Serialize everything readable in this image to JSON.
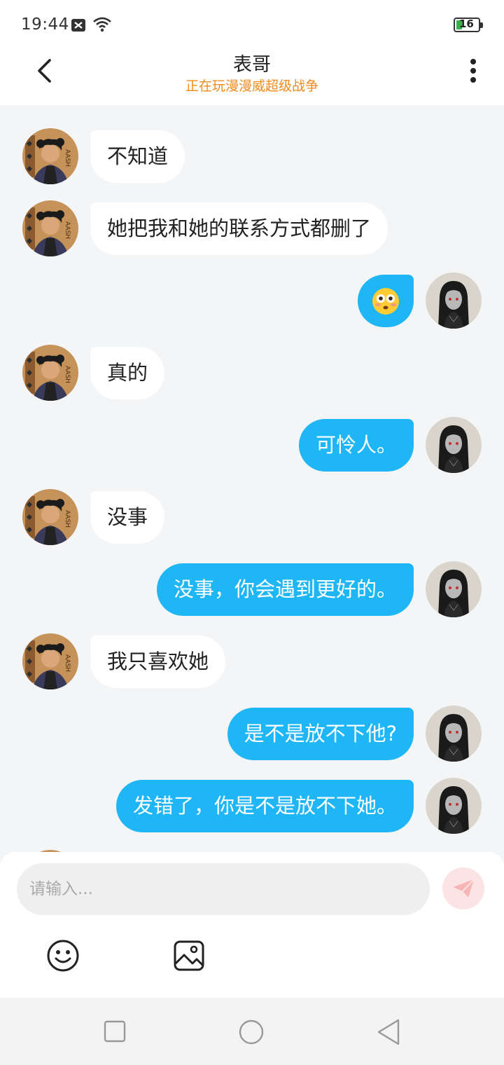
{
  "status_bar": {
    "time": "19:44",
    "battery": "16"
  },
  "header": {
    "title": "表哥",
    "subtitle": "正在玩漫漫威超级战争"
  },
  "messages": [
    {
      "side": "left",
      "text": "不知道"
    },
    {
      "side": "left",
      "text": "她把我和她的联系方式都删了"
    },
    {
      "side": "right",
      "text": "😳"
    },
    {
      "side": "left",
      "text": "真的"
    },
    {
      "side": "right",
      "text": "可怜人。"
    },
    {
      "side": "left",
      "text": "没事"
    },
    {
      "side": "right",
      "text": "没事，你会遇到更好的。"
    },
    {
      "side": "left",
      "text": "我只喜欢她"
    },
    {
      "side": "right",
      "text": "是不是放不下他?"
    },
    {
      "side": "right",
      "text": "发错了，你是不是放不下她。"
    }
  ],
  "composer": {
    "placeholder": "请输入..."
  },
  "colors": {
    "sent_bubble": "#1fb6f5",
    "received_bubble": "#ffffff",
    "subtitle": "#f08a1c",
    "send_button": "#fde4e4"
  },
  "icons": {
    "back": "chevron-left-icon",
    "more": "vertical-dots-icon",
    "send": "paper-plane-icon",
    "emoji": "smiley-icon",
    "image": "image-icon",
    "nav_recent": "square-icon",
    "nav_home": "circle-icon",
    "nav_back": "triangle-back-icon"
  }
}
